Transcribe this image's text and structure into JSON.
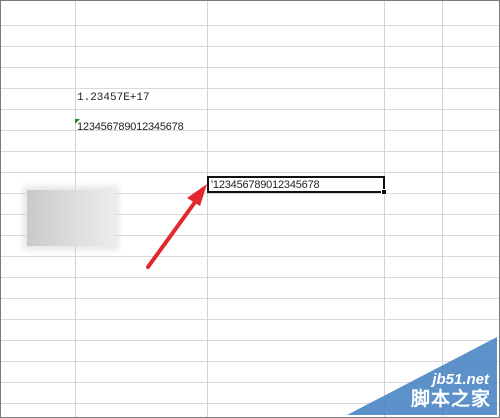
{
  "sheet": {
    "cells": {
      "scientific_value": "1.23457E+17",
      "text_number_value": "123456789012345678",
      "active_cell_value": "'123456789012345678"
    }
  },
  "annotation": {
    "arrow_color": "#e0282e"
  },
  "watermark": {
    "site": "jb51.net",
    "name": "脚本之家"
  }
}
